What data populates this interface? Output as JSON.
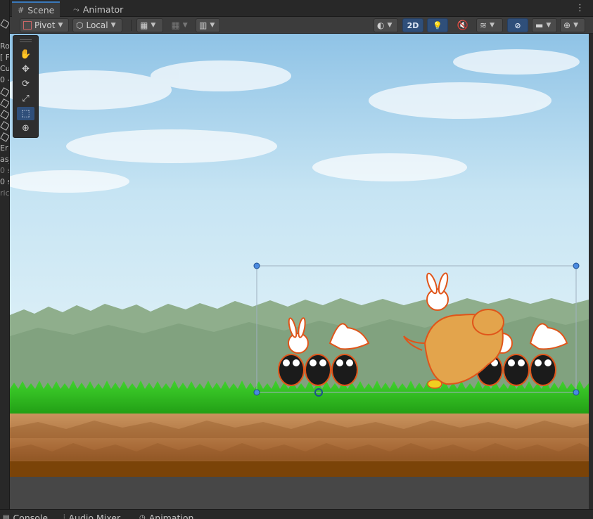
{
  "hierarchy_sliver": [
    {
      "text": "Ro",
      "dim": false
    },
    {
      "text": "[ F",
      "dim": false
    },
    {
      "text": "Cu",
      "dim": false
    },
    {
      "text": "0 -",
      "dim": false
    },
    {
      "text": "Er",
      "dim": false
    },
    {
      "text": "as_",
      "dim": false
    },
    {
      "text": "0 s",
      "dim": true
    },
    {
      "text": "0 s",
      "dim": false
    },
    {
      "text": "ric",
      "dim": true
    }
  ],
  "tabs": [
    {
      "label": "Scene",
      "icon": "scene-grid-icon",
      "active": true
    },
    {
      "label": "Animator",
      "icon": "animator-icon",
      "active": false
    }
  ],
  "toolbar": {
    "pivot_label": "Pivot",
    "local_label": "Local",
    "mode_2d_label": "2D"
  },
  "tools": [
    {
      "name": "hand-tool",
      "icon": "hand-icon",
      "selected": false
    },
    {
      "name": "move-tool",
      "icon": "move-icon",
      "selected": false
    },
    {
      "name": "rotate-tool",
      "icon": "rotate-icon",
      "selected": false
    },
    {
      "name": "scale-tool",
      "icon": "scale-icon",
      "selected": false
    },
    {
      "name": "rect-tool",
      "icon": "rect-transform-icon",
      "selected": true
    },
    {
      "name": "transform-tool",
      "icon": "transform-icon",
      "selected": false
    }
  ],
  "bottom_tabs": [
    {
      "label": "Console",
      "icon": "console-icon"
    },
    {
      "label": "Audio Mixer",
      "icon": "audio-mixer-icon"
    },
    {
      "label": "Animation",
      "icon": "animation-icon"
    }
  ],
  "colors": {
    "accent": "#3a79bb",
    "selected_button": "#2f4f7a",
    "sky_top": "#8fc3e6",
    "sky_bottom": "#dcf0f8",
    "grass": "#2fbf1f",
    "dirt": "#b07542"
  }
}
